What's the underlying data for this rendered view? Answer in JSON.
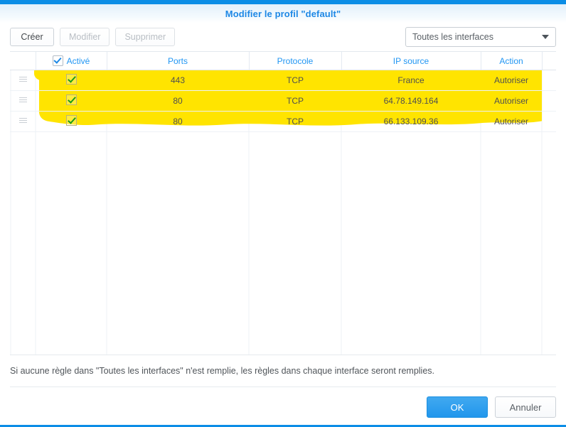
{
  "dialog": {
    "title": "Modifier le profil \"default\""
  },
  "toolbar": {
    "create_label": "Créer",
    "edit_label": "Modifier",
    "delete_label": "Supprimer",
    "interface_select": {
      "value": "Toutes les interfaces",
      "options": [
        "Toutes les interfaces"
      ]
    }
  },
  "table": {
    "columns": [
      {
        "key": "handle",
        "label": ""
      },
      {
        "key": "enabled",
        "label": "Activé"
      },
      {
        "key": "ports",
        "label": "Ports"
      },
      {
        "key": "protocol",
        "label": "Protocole"
      },
      {
        "key": "source_ip",
        "label": "IP source"
      },
      {
        "key": "action",
        "label": "Action"
      },
      {
        "key": "filler",
        "label": ""
      }
    ],
    "header_checkbox_checked": true,
    "rows": [
      {
        "enabled": true,
        "ports": "443",
        "protocol": "TCP",
        "source_ip": "France",
        "action": "Autoriser"
      },
      {
        "enabled": true,
        "ports": "80",
        "protocol": "TCP",
        "source_ip": "64.78.149.164",
        "action": "Autoriser"
      },
      {
        "enabled": true,
        "ports": "80",
        "protocol": "TCP",
        "source_ip": "66.133.109.36",
        "action": "Autoriser"
      }
    ]
  },
  "note": {
    "text": "Si aucune règle dans \"Toutes les interfaces\" n'est remplie, les règles dans chaque interface seront remplies."
  },
  "footer": {
    "ok_label": "OK",
    "cancel_label": "Annuler"
  },
  "annotation": {
    "highlight_color": "#ffe400",
    "type": "marker-highlight",
    "covers": "all three firewall rule rows"
  },
  "colors": {
    "accent_bar": "#0b8de6",
    "title": "#1e88e5",
    "header_text": "#2196f3",
    "primary_button": "#2196ec",
    "row_check": "#1a9c1a"
  }
}
